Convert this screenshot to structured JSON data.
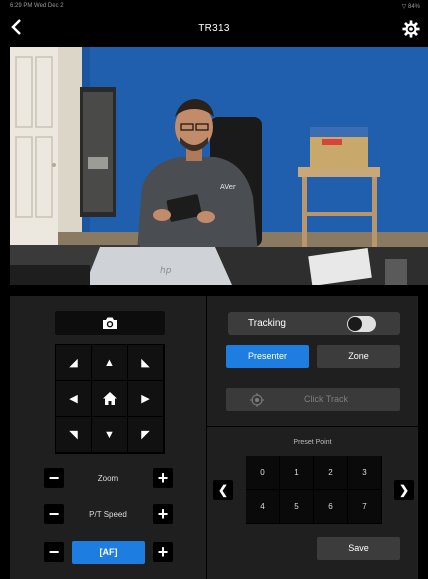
{
  "status_bar": {
    "time_date": "6:29 PM  Wed Dec 2",
    "indicators": "▽ 84%"
  },
  "nav": {
    "title": "TR313",
    "back_icon": "chevron-left-icon",
    "settings_icon": "gear-icon"
  },
  "camera_feed": {
    "badge_text": "AVer",
    "screen_logo": "hp"
  },
  "controls": {
    "snapshot_icon": "camera-icon",
    "dpad": {
      "up_left": "◢",
      "up": "▲",
      "up_right": "◣",
      "left": "◀",
      "home": "home-icon",
      "right": "▶",
      "down_left": "◥",
      "down": "▼",
      "down_right": "◤"
    },
    "zoom_label": "Zoom",
    "pt_speed_label": "P/T Speed",
    "af_label": "[AF]",
    "minus": "−",
    "plus": "+"
  },
  "tracking": {
    "label": "Tracking",
    "enabled": false
  },
  "mode": {
    "presenter": "Presenter",
    "zone": "Zone",
    "selected": "Presenter"
  },
  "click_track": {
    "label": "Click Track",
    "enabled": false
  },
  "preset": {
    "title": "Preset Point",
    "points": [
      "0",
      "1",
      "2",
      "3",
      "4",
      "5",
      "6",
      "7"
    ],
    "prev": "❮",
    "next": "❯",
    "save_label": "Save"
  },
  "colors": {
    "accent": "#1e7de0",
    "panel": "#1f1f1f",
    "background": "#000000"
  }
}
